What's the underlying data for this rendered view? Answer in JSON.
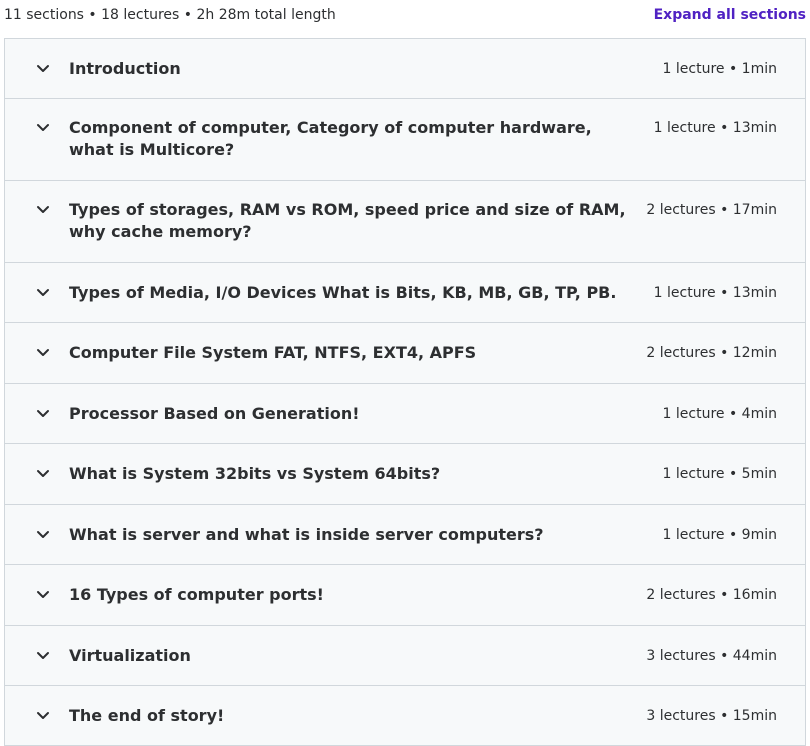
{
  "summary": {
    "stats": "11 sections • 18 lectures • 2h 28m total length",
    "expand_label": "Expand all sections"
  },
  "icons": {
    "section_toggle": "chevron-down-icon"
  },
  "colors": {
    "accent": "#5022c3",
    "section_bg": "#f7f9fa",
    "border": "#d1d7dc",
    "text": "#2d2f31"
  },
  "sections": [
    {
      "title": "Introduction",
      "meta": "1 lecture • 1min"
    },
    {
      "title": "Component of computer, Category of computer hardware, what is Multicore?",
      "meta": "1 lecture • 13min"
    },
    {
      "title": "Types of storages, RAM vs ROM, speed price and size of RAM, why cache memory?",
      "meta": "2 lectures • 17min"
    },
    {
      "title": "Types of Media, I/O Devices What is Bits, KB, MB, GB, TP, PB.",
      "meta": "1 lecture • 13min"
    },
    {
      "title": "Computer File System FAT, NTFS, EXT4, APFS",
      "meta": "2 lectures • 12min"
    },
    {
      "title": "Processor Based on Generation!",
      "meta": "1 lecture • 4min"
    },
    {
      "title": "What is System 32bits vs System 64bits?",
      "meta": "1 lecture • 5min"
    },
    {
      "title": "What is server and what is inside server computers?",
      "meta": "1 lecture • 9min"
    },
    {
      "title": "16 Types of computer ports!",
      "meta": "2 lectures • 16min"
    },
    {
      "title": "Virtualization",
      "meta": "3 lectures • 44min"
    },
    {
      "title": "The end of story!",
      "meta": "3 lectures • 15min"
    }
  ]
}
